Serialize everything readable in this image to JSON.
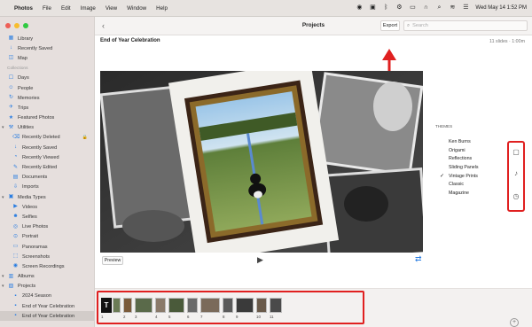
{
  "menubar": {
    "app": "Photos",
    "items": [
      "File",
      "Edit",
      "Image",
      "View",
      "Window",
      "Help"
    ],
    "datetime": "Wed May 14  1:52 PM"
  },
  "sidebar": {
    "items": [
      {
        "label": "Library",
        "icon": "library-icon",
        "kind": "item"
      },
      {
        "label": "Recently Saved",
        "icon": "recently-saved-icon",
        "kind": "item"
      },
      {
        "label": "Map",
        "icon": "map-icon",
        "kind": "item"
      },
      {
        "label": "Collections",
        "kind": "section"
      },
      {
        "label": "Days",
        "icon": "days-icon",
        "kind": "item"
      },
      {
        "label": "People",
        "icon": "people-icon",
        "kind": "item"
      },
      {
        "label": "Memories",
        "icon": "memories-icon",
        "kind": "item"
      },
      {
        "label": "Trips",
        "icon": "trips-icon",
        "kind": "item"
      },
      {
        "label": "Featured Photos",
        "icon": "featured-icon",
        "kind": "item"
      },
      {
        "label": "Utilities",
        "icon": "utilities-icon",
        "kind": "group"
      },
      {
        "label": "Recently Deleted",
        "icon": "trash-icon",
        "kind": "sub",
        "lock": true
      },
      {
        "label": "Recently Saved",
        "icon": "recently-saved-icon",
        "kind": "sub"
      },
      {
        "label": "Recently Viewed",
        "icon": "recently-viewed-icon",
        "kind": "sub"
      },
      {
        "label": "Recently Edited",
        "icon": "recently-edited-icon",
        "kind": "sub"
      },
      {
        "label": "Documents",
        "icon": "documents-icon",
        "kind": "sub"
      },
      {
        "label": "Imports",
        "icon": "imports-icon",
        "kind": "sub"
      },
      {
        "label": "Media Types",
        "icon": "media-types-icon",
        "kind": "group"
      },
      {
        "label": "Videos",
        "icon": "videos-icon",
        "kind": "sub"
      },
      {
        "label": "Selfies",
        "icon": "selfies-icon",
        "kind": "sub"
      },
      {
        "label": "Live Photos",
        "icon": "live-photos-icon",
        "kind": "sub"
      },
      {
        "label": "Portrait",
        "icon": "portrait-icon",
        "kind": "sub"
      },
      {
        "label": "Panoramas",
        "icon": "panoramas-icon",
        "kind": "sub"
      },
      {
        "label": "Screenshots",
        "icon": "screenshots-icon",
        "kind": "sub"
      },
      {
        "label": "Screen Recordings",
        "icon": "screen-recordings-icon",
        "kind": "sub"
      },
      {
        "label": "Albums",
        "icon": "albums-icon",
        "kind": "group"
      },
      {
        "label": "Projects",
        "icon": "projects-icon",
        "kind": "group"
      },
      {
        "label": "2024 Season",
        "icon": "project-icon",
        "kind": "sub"
      },
      {
        "label": "End of Year Celebration",
        "icon": "project-icon",
        "kind": "sub"
      },
      {
        "label": "End of Year Celebration",
        "icon": "project-icon",
        "kind": "sub",
        "selected": true
      }
    ]
  },
  "toolbar": {
    "title": "Projects",
    "export_label": "Export",
    "search_placeholder": "Search"
  },
  "project": {
    "title": "End of Year Celebration",
    "info": "11 slides · 1:00m"
  },
  "controls": {
    "preview_label": "Preview"
  },
  "themes": {
    "label": "THEMES",
    "items": [
      "Ken Burns",
      "Origami",
      "Reflections",
      "Sliding Panels",
      "Vintage Prints",
      "Classic",
      "Magazine"
    ],
    "selected": "Vintage Prints"
  },
  "filmstrip": {
    "clips": [
      {
        "num": "1"
      },
      {
        "num": "2"
      },
      {
        "num": "3"
      },
      {
        "num": "4"
      },
      {
        "num": "5"
      },
      {
        "num": "6"
      },
      {
        "num": "7"
      },
      {
        "num": "8"
      },
      {
        "num": "9"
      },
      {
        "num": "10"
      },
      {
        "num": "11"
      }
    ]
  },
  "colors": {
    "accent": "#2a7de1",
    "annotation_red": "#e02020"
  }
}
